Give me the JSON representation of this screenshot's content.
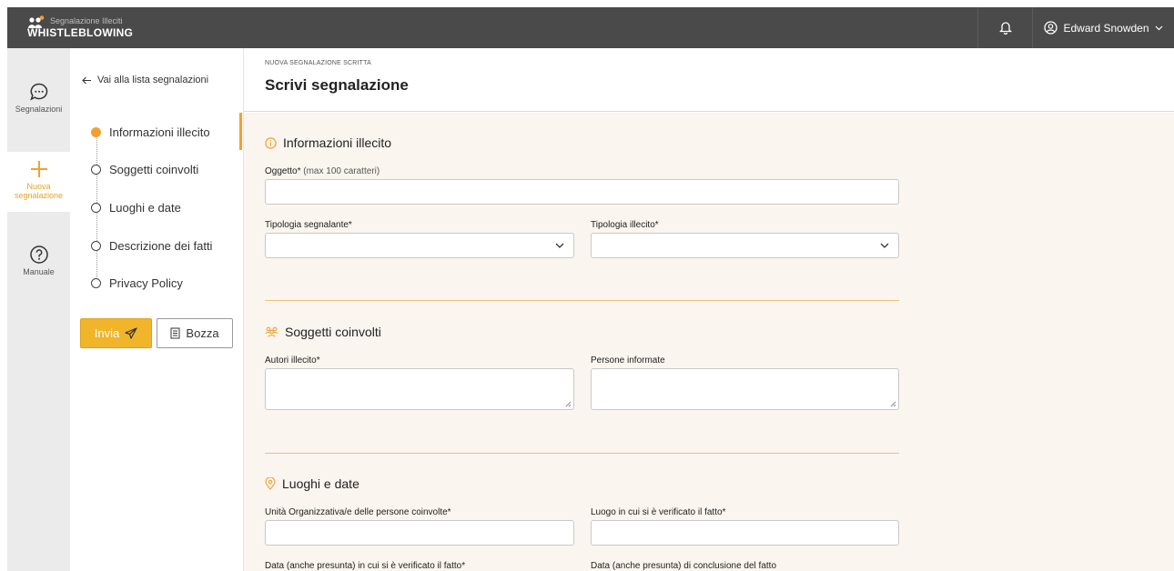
{
  "brand": {
    "subtitle": "Segnalazione Illeciti",
    "name": "WHISTLEBLOWING"
  },
  "user": {
    "name": "Edward Snowden"
  },
  "rail": [
    {
      "label": "Segnalazioni",
      "icon": "chat-bubble-icon"
    },
    {
      "label": "Nuova segnalazione",
      "icon": "plus-icon"
    },
    {
      "label": "Manuale",
      "icon": "help-circle-icon"
    }
  ],
  "nav": {
    "back_label": "Vai alla lista segnalazioni",
    "steps": [
      {
        "label": "Informazioni illecito",
        "active": true
      },
      {
        "label": "Soggetti coinvolti",
        "active": false
      },
      {
        "label": "Luoghi e date",
        "active": false
      },
      {
        "label": "Descrizione dei fatti",
        "active": false
      },
      {
        "label": "Privacy Policy",
        "active": false
      }
    ],
    "send_label": "Invia",
    "draft_label": "Bozza"
  },
  "header": {
    "eyebrow": "NUOVA SEGNALAZIONE SCRITTA",
    "title": "Scrivi segnalazione"
  },
  "sections": {
    "info": {
      "title": "Informazioni illecito",
      "oggetto_label": "Oggetto*",
      "oggetto_hint": "(max 100 caratteri)",
      "oggetto_value": "",
      "tipologia_segnalante_label": "Tipologia segnalante*",
      "tipologia_segnalante_value": "",
      "tipologia_illecito_label": "Tipologia illecito*",
      "tipologia_illecito_value": ""
    },
    "soggetti": {
      "title": "Soggetti coinvolti",
      "autori_label": "Autori illecito*",
      "autori_value": "",
      "persone_label": "Persone informate",
      "persone_value": ""
    },
    "luoghi": {
      "title": "Luoghi e date",
      "unita_label": "Unità Organizzativa/e delle persone coinvolte*",
      "unita_value": "",
      "luogo_label": "Luogo in cui si è verificato il fatto*",
      "luogo_value": "",
      "data_inizio_label": "Data (anche presunta) in cui si è verificato il fatto*",
      "data_fine_label": "Data (anche presunta) di conclusione del fatto"
    }
  },
  "colors": {
    "accent": "#f0a12e",
    "topbar": "#4a4a4a",
    "content_bg": "#faf5ef"
  }
}
